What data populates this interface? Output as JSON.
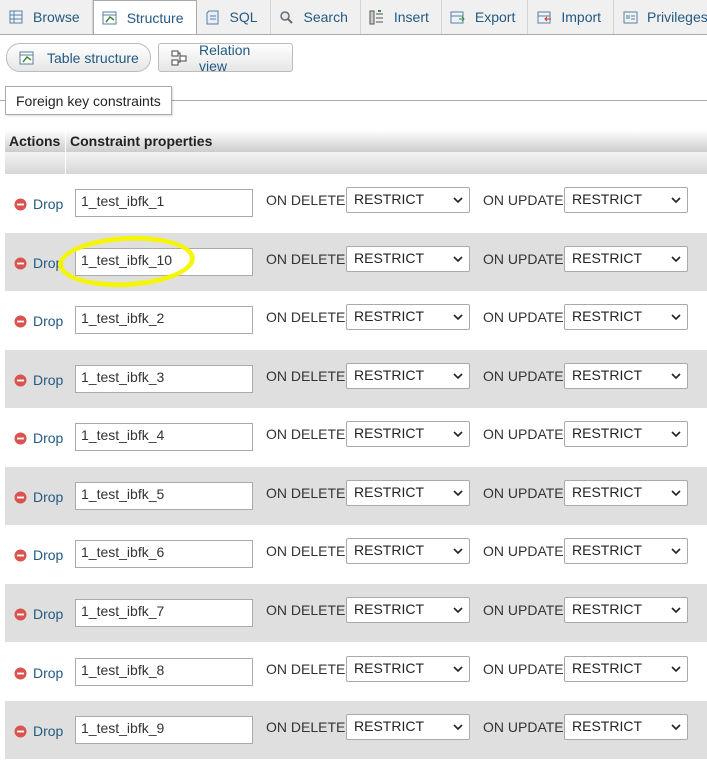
{
  "tabs": [
    {
      "label": "Browse",
      "icon": "browse-icon",
      "active": false
    },
    {
      "label": "Structure",
      "icon": "structure-icon",
      "active": true
    },
    {
      "label": "SQL",
      "icon": "sql-icon",
      "active": false
    },
    {
      "label": "Search",
      "icon": "search-icon",
      "active": false
    },
    {
      "label": "Insert",
      "icon": "insert-icon",
      "active": false
    },
    {
      "label": "Export",
      "icon": "export-icon",
      "active": false
    },
    {
      "label": "Import",
      "icon": "import-icon",
      "active": false
    },
    {
      "label": "Privileges",
      "icon": "privileges-icon",
      "active": false
    }
  ],
  "subnav": {
    "table_structure": "Table structure",
    "relation_view": "Relation view"
  },
  "section_title": "Foreign key constraints",
  "table": {
    "col_actions": "Actions",
    "col_properties": "Constraint properties",
    "on_delete_label": "ON DELETE",
    "on_update_label": "ON UPDATE",
    "drop_label": "Drop",
    "rows": [
      {
        "name": "1_test_ibfk_1",
        "on_delete": "RESTRICT",
        "on_update": "RESTRICT"
      },
      {
        "name": "1_test_ibfk_10",
        "on_delete": "RESTRICT",
        "on_update": "RESTRICT"
      },
      {
        "name": "1_test_ibfk_2",
        "on_delete": "RESTRICT",
        "on_update": "RESTRICT"
      },
      {
        "name": "1_test_ibfk_3",
        "on_delete": "RESTRICT",
        "on_update": "RESTRICT"
      },
      {
        "name": "1_test_ibfk_4",
        "on_delete": "RESTRICT",
        "on_update": "RESTRICT"
      },
      {
        "name": "1_test_ibfk_5",
        "on_delete": "RESTRICT",
        "on_update": "RESTRICT"
      },
      {
        "name": "1_test_ibfk_6",
        "on_delete": "RESTRICT",
        "on_update": "RESTRICT"
      },
      {
        "name": "1_test_ibfk_7",
        "on_delete": "RESTRICT",
        "on_update": "RESTRICT"
      },
      {
        "name": "1_test_ibfk_8",
        "on_delete": "RESTRICT",
        "on_update": "RESTRICT"
      },
      {
        "name": "1_test_ibfk_9",
        "on_delete": "RESTRICT",
        "on_update": "RESTRICT"
      }
    ]
  },
  "annotation": {
    "highlighted_row": "1_test_ibfk_10",
    "color": "#f5f500"
  },
  "colors": {
    "link": "#235a81",
    "drop_icon": "#d9534f",
    "row_alt": "#dfdfdf"
  }
}
